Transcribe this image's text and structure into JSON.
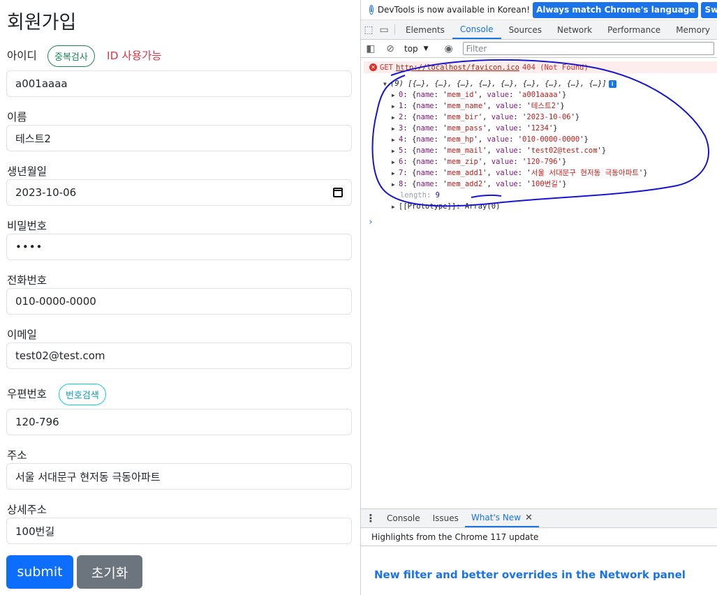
{
  "form": {
    "title": "회원가입",
    "id": {
      "label": "아이디",
      "check_button": "중복검사",
      "status": "ID 사용가능",
      "value": "a001aaaa"
    },
    "name": {
      "label": "이름",
      "value": "테스트2"
    },
    "birth": {
      "label": "생년월일",
      "value": "2023-10-06"
    },
    "password": {
      "label": "비밀번호",
      "value": "••••"
    },
    "phone": {
      "label": "전화번호",
      "value": "010-0000-0000"
    },
    "email": {
      "label": "이메일",
      "value": "test02@test.com"
    },
    "zip": {
      "label": "우편번호",
      "search_button": "번호검색",
      "value": "120-796"
    },
    "address": {
      "label": "주소",
      "value": "서울 서대문구 현저동 극동아파트"
    },
    "address_detail": {
      "label": "상세주소",
      "value": "100번길"
    },
    "submit_label": "submit",
    "reset_label": "초기화"
  },
  "devtools": {
    "banner": {
      "text": "DevTools is now available in Korean!",
      "match_button": "Always match Chrome's language",
      "switch_button": "Switch DevTools"
    },
    "tabs": [
      "Elements",
      "Console",
      "Sources",
      "Network",
      "Performance",
      "Memory"
    ],
    "active_tab": "Console",
    "toolbar": {
      "context": "top",
      "filter_placeholder": "Filter"
    },
    "console": {
      "error": {
        "method": "GET",
        "url": "http://localhost/favicon.ico",
        "status": "404 (Not Found)"
      },
      "array_summary": "(9) [{…}, {…}, {…}, {…}, {…}, {…}, {…}, {…}, {…}]",
      "items": [
        {
          "index": "0",
          "name": "mem_id",
          "value": "a001aaaa"
        },
        {
          "index": "1",
          "name": "mem_name",
          "value": "테스트2"
        },
        {
          "index": "2",
          "name": "mem_bir",
          "value": "2023-10-06"
        },
        {
          "index": "3",
          "name": "mem_pass",
          "value": "1234"
        },
        {
          "index": "4",
          "name": "mem_hp",
          "value": "010-0000-0000"
        },
        {
          "index": "5",
          "name": "mem_mail",
          "value": "test02@test.com"
        },
        {
          "index": "6",
          "name": "mem_zip",
          "value": "120-796"
        },
        {
          "index": "7",
          "name": "mem_add1",
          "value": "서울 서대문구 현저동 극동아파트"
        },
        {
          "index": "8",
          "name": "mem_add2",
          "value": "100번길"
        }
      ],
      "length_key": "length",
      "length_value": "9",
      "prototype": "[[Prototype]]: Array(0)",
      "prompt": "›"
    },
    "drawer": {
      "tabs": [
        "Console",
        "Issues",
        "What's New"
      ],
      "active_tab": "What's New",
      "highlights": "Highlights from the Chrome 117 update",
      "feature_title": "New filter and better overrides in the Network panel"
    },
    "colors": {
      "accent": "#1a73e8",
      "error": "#d93025",
      "annotation": "#1515d4"
    }
  }
}
